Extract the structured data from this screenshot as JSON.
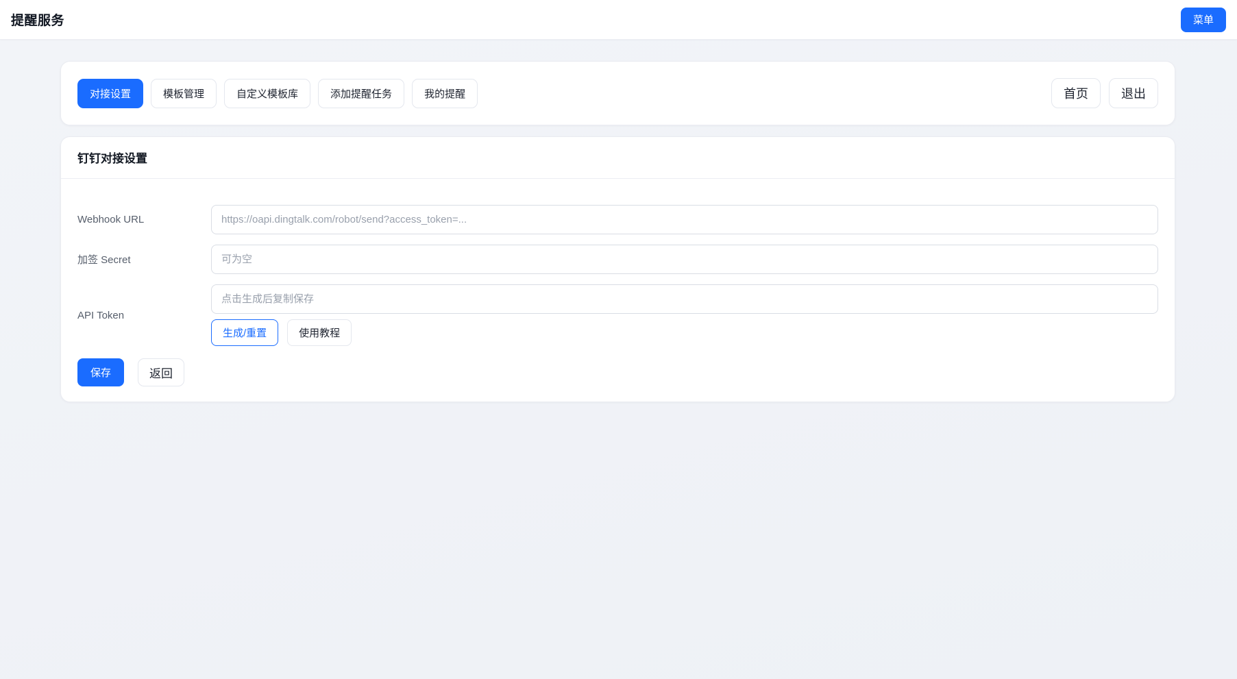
{
  "header": {
    "title": "提醒服务",
    "menu_button_label": "菜单"
  },
  "nav": {
    "tabs": [
      {
        "label": "对接设置",
        "active": true
      },
      {
        "label": "模板管理",
        "active": false
      },
      {
        "label": "自定义模板库",
        "active": false
      },
      {
        "label": "添加提醒任务",
        "active": false
      },
      {
        "label": "我的提醒",
        "active": false
      }
    ],
    "home_button_label": "首页",
    "exit_button_label": "退出"
  },
  "settings_card": {
    "title": "钉钉对接设置",
    "fields": [
      {
        "label": "Webhook URL",
        "value": "",
        "placeholder": "https://oapi.dingtalk.com/robot/send?access_token=..."
      },
      {
        "label": "加签 Secret",
        "value": "",
        "placeholder": "可为空"
      },
      {
        "label": "API Token",
        "value": "",
        "placeholder": "点击生成后复制保存"
      }
    ],
    "generate_reset_button_label": "生成/重置",
    "tutorial_button_label": "使用教程",
    "save_button_label": "保存",
    "back_button_label": "返回"
  },
  "colors": {
    "primary": "#1a6cff",
    "page_background": "#f0f2f7"
  }
}
